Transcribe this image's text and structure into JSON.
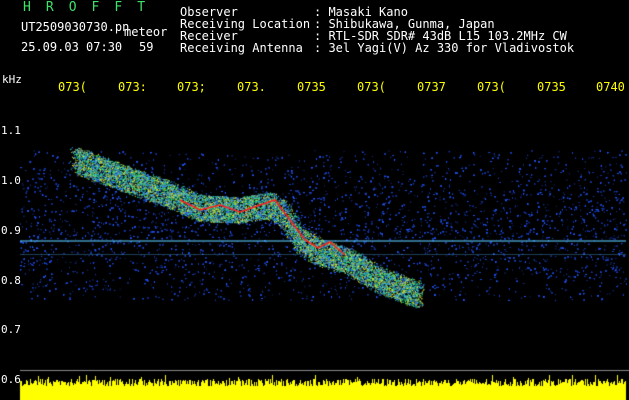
{
  "header": {
    "logo": "H R O F F T",
    "file_name": "UT2509030730.pn",
    "meteor_label": "meteor",
    "datetime": "25.09.03 07:30",
    "count": "59",
    "fields": [
      {
        "label": "Observer",
        "value": ": Masaki Kano"
      },
      {
        "label": "Receiving Location",
        "value": ": Shibukawa, Gunma, Japan"
      },
      {
        "label": "Receiver",
        "value": ": RTL-SDR SDR# 43dB L15 103.2MHz CW"
      },
      {
        "label": "Receiving Antenna",
        "value": ": 3el Yagi(V) Az 330 for Vladivostok"
      }
    ]
  },
  "spectrogram": {
    "y_unit": "kHz",
    "y_ticks": [
      "1.1",
      "1.0",
      "0.9",
      "0.8",
      "0.7",
      "0.6"
    ],
    "time_ticks": [
      "073(",
      "073:",
      "073;",
      "073.",
      "0735",
      "073(",
      "0737",
      "073(",
      "0735",
      "0740"
    ],
    "colors": {
      "background": "#000000",
      "noise": "#1a3cff",
      "signal": "#ff2020",
      "power": "#ffff00"
    }
  }
}
